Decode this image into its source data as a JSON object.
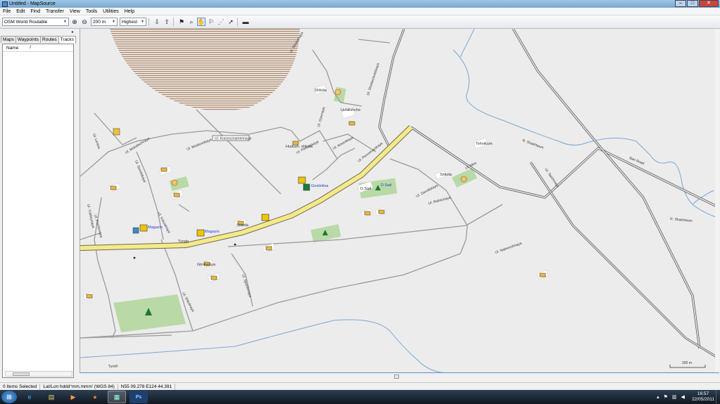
{
  "window": {
    "title": "Untitled - MapSource",
    "minimize": "–",
    "maximize": "□",
    "close": "✕"
  },
  "menu": [
    "File",
    "Edit",
    "Find",
    "Transfer",
    "View",
    "Tools",
    "Utilities",
    "Help"
  ],
  "toolbar": {
    "map_product": "OSM World Routable",
    "zoom_scale": "200 m",
    "detail_level": "Highest"
  },
  "left_panel": {
    "tabs": [
      "Maps",
      "Waypoints",
      "Routes",
      "Tracks"
    ],
    "active_tab": "Tracks",
    "column_header": "Name",
    "sort_mark": "/"
  },
  "map": {
    "street_labels": [
      "Ul. Shishechvetskaya",
      "Ul. Molodezhnaya",
      "Ul. Lenina",
      "Ul. Moskovskaya",
      "Ul. Pionerskaya",
      "Ul. Amurskaya",
      "Ul. Pervomayskaya",
      "Ul. Zavodskaya",
      "Ul. Mira",
      "Ul. Sovetskaya",
      "Ul. Yubileynaya",
      "Ul. Shkolnaya",
      "Ul. Sportivnaya",
      "Ul. Taezhnaya",
      "Ul. Pochtovaya",
      "Ul. Vokzalnaya",
      "Ul. Rabochaya",
      "Ul. Stroitelnaya",
      "Ul. Naberezhnaya",
      "Ul. Ozernaya"
    ],
    "river_labels": [
      "R. Shakhtaum",
      "R. Shakhtaum",
      "Tynde"
    ],
    "road_labels": [
      "Ban Road"
    ],
    "poi_labels": [
      "Shkola",
      "Uchilishche",
      "Hudozh. shkola",
      "Gostinitsa",
      "D.Sad",
      "D.Sad",
      "Magazin",
      "Magazin",
      "Tynda",
      "Shkola",
      "Gimnaziya",
      "Shkola",
      "Tehnikum"
    ],
    "callout": "Ul. Krasnoznamennaya",
    "scale_label": "200 m"
  },
  "status": {
    "selection": "0 Items Selected",
    "position_format": "Lat/Lon hddd°mm.mmm' (WGS 84)",
    "coordinates": "N55 09.278 E124 44.391"
  },
  "taskbar": {
    "time": "16:57",
    "date": "22/05/2011"
  }
}
